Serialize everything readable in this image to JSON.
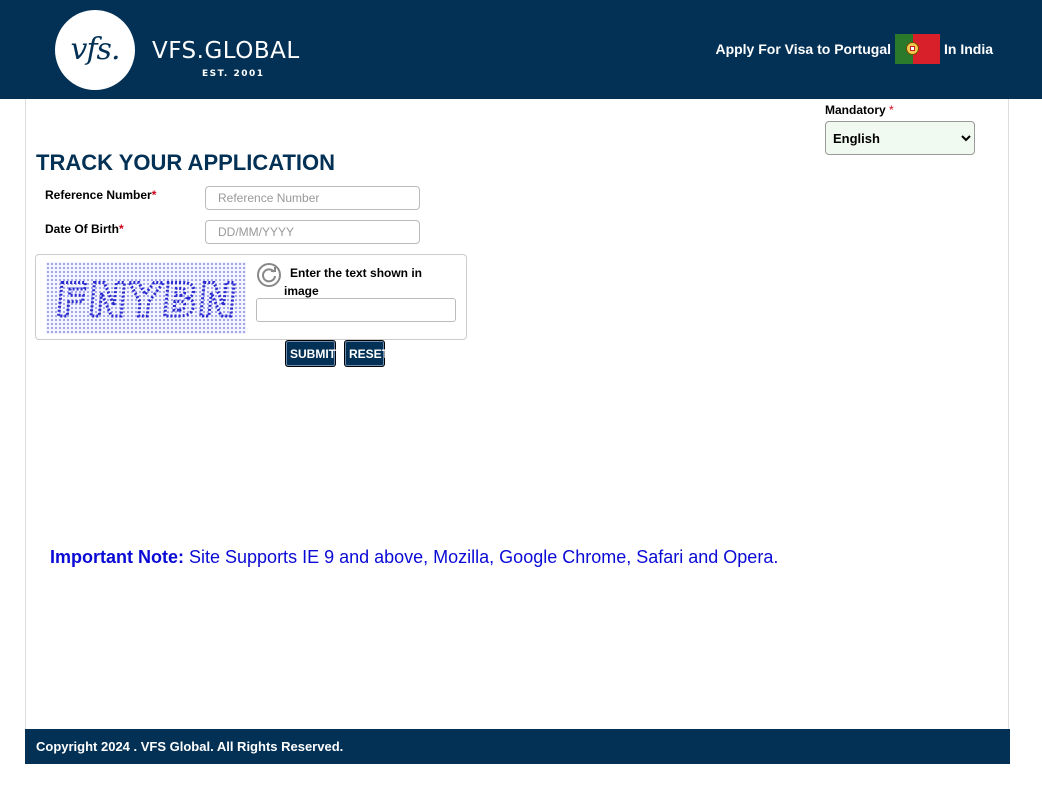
{
  "header": {
    "logo_mark": "vfs.",
    "brand": "VFS.GLOBAL",
    "est": "EST. 2001",
    "tagline_pre": "Apply For Visa to Portugal",
    "tagline_post": "In India",
    "flag_icon": "portugal-flag-icon"
  },
  "language": {
    "label": "Mandatory",
    "required_mark": "*",
    "selected": "English",
    "options": [
      "English"
    ]
  },
  "form": {
    "title": "TRACK YOUR APPLICATION",
    "reference_label": "Reference Number",
    "reference_placeholder": "Reference Number",
    "dob_label": "Date Of Birth",
    "dob_placeholder": "DD/MM/YYYY",
    "required_mark": "*"
  },
  "captcha": {
    "image_text": "FNYBN",
    "refresh_icon": "refresh-icon",
    "label": "Enter the text shown in image",
    "input_value": ""
  },
  "buttons": {
    "submit": "SUBMIT",
    "reset": "RESET"
  },
  "note": {
    "prefix": "Important Note:",
    "text": " Site Supports IE 9 and above, Mozilla, Google Chrome, Safari and Opera."
  },
  "footer": {
    "copyright": "Copyright 2024 . VFS Global. All Rights Reserved."
  },
  "colors": {
    "brand_navy": "#033155",
    "note_blue": "#0a0ad6",
    "required_red": "#d0021b"
  }
}
